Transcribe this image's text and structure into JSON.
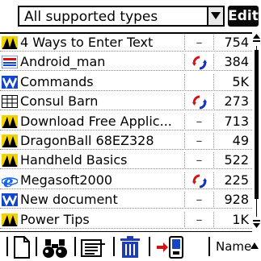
{
  "filter": {
    "selected": "All supported types"
  },
  "edit_button": {
    "label": "Edit"
  },
  "files": [
    {
      "name": "4 Ways to Enter Text",
      "icon": "documents-to-go-icon",
      "status": "–",
      "size": "754"
    },
    {
      "name": "Android_man",
      "icon": "image-file-icon",
      "status": "sync-icon",
      "size": "384"
    },
    {
      "name": "Commands",
      "icon": "word-document-icon",
      "status": "",
      "size": "5K"
    },
    {
      "name": "Consul Barn",
      "icon": "spreadsheet-icon",
      "status": "sync-icon",
      "size": "273"
    },
    {
      "name": "Download Free Applic...",
      "icon": "documents-to-go-icon",
      "status": "–",
      "size": "713"
    },
    {
      "name": "DragonBall 68EZ328",
      "icon": "documents-to-go-icon",
      "status": "–",
      "size": "49"
    },
    {
      "name": "Handheld Basics",
      "icon": "documents-to-go-icon",
      "status": "–",
      "size": "522"
    },
    {
      "name": "Megasoft2000",
      "icon": "internet-explorer-icon",
      "status": "sync-icon",
      "size": "225"
    },
    {
      "name": "New document",
      "icon": "word-document-icon",
      "status": "–",
      "size": "928"
    },
    {
      "name": "Power Tips",
      "icon": "documents-to-go-icon",
      "status": "–",
      "size": "1K"
    }
  ],
  "toolbar": {
    "sort_label": "Name",
    "buttons": [
      "new-document-icon",
      "find-binoculars-icon",
      "details-icon",
      "delete-trash-icon",
      "beam-send-icon"
    ]
  },
  "colors": {
    "docs_to_go_yellow": "#f2d200",
    "word_blue": "#1446c8",
    "sync_red": "#d21414",
    "sync_blue": "#1432c8",
    "ie_blue": "#1464e6",
    "trash_blue": "#1e3cb4"
  }
}
